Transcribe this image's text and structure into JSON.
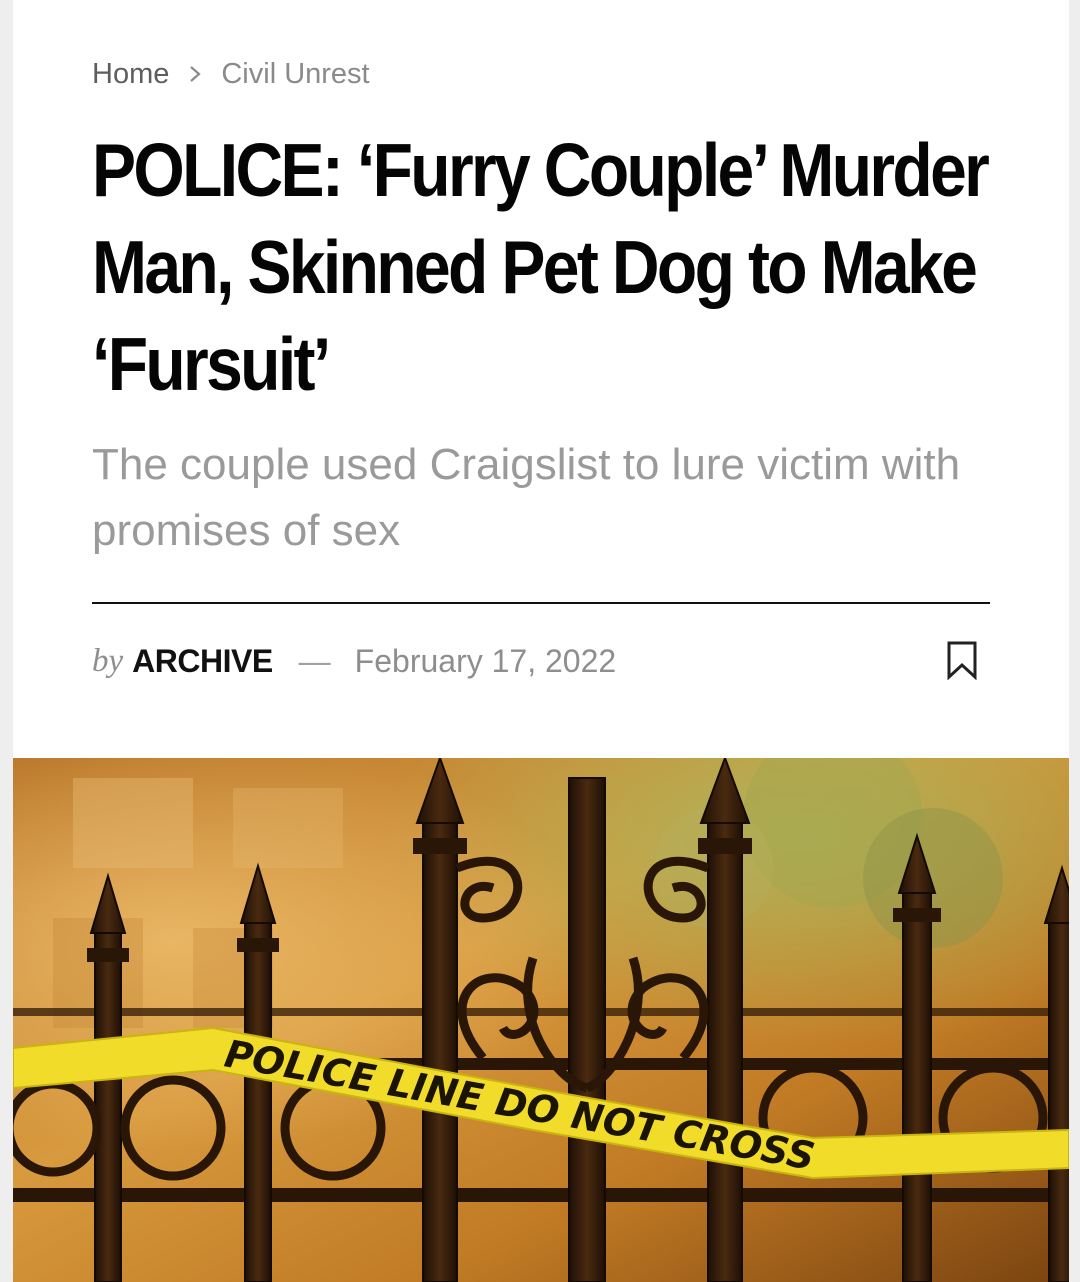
{
  "breadcrumb": {
    "home": "Home",
    "separator_icon": "chevron-right-icon",
    "current": "Civil Unrest"
  },
  "article": {
    "title": "POLICE: ‘Furry Couple’ Murder Man, Skinned Pet Dog to Make ‘Fursuit’",
    "subtitle": "The couple used Craigslist to lure victim with promises of sex",
    "byline_prefix": "by",
    "author": "ARCHIVE",
    "byline_separator": "—",
    "date": "February 17, 2022",
    "bookmark_icon": "bookmark-icon"
  },
  "hero_image": {
    "tape_text": "POLICE LINE DO NOT CROSS"
  },
  "colors": {
    "title": "#050505",
    "subtitle": "#9a9a9a",
    "tape": "#f2dc2a",
    "page_bg": "#eeeeee",
    "card_bg": "#ffffff"
  }
}
